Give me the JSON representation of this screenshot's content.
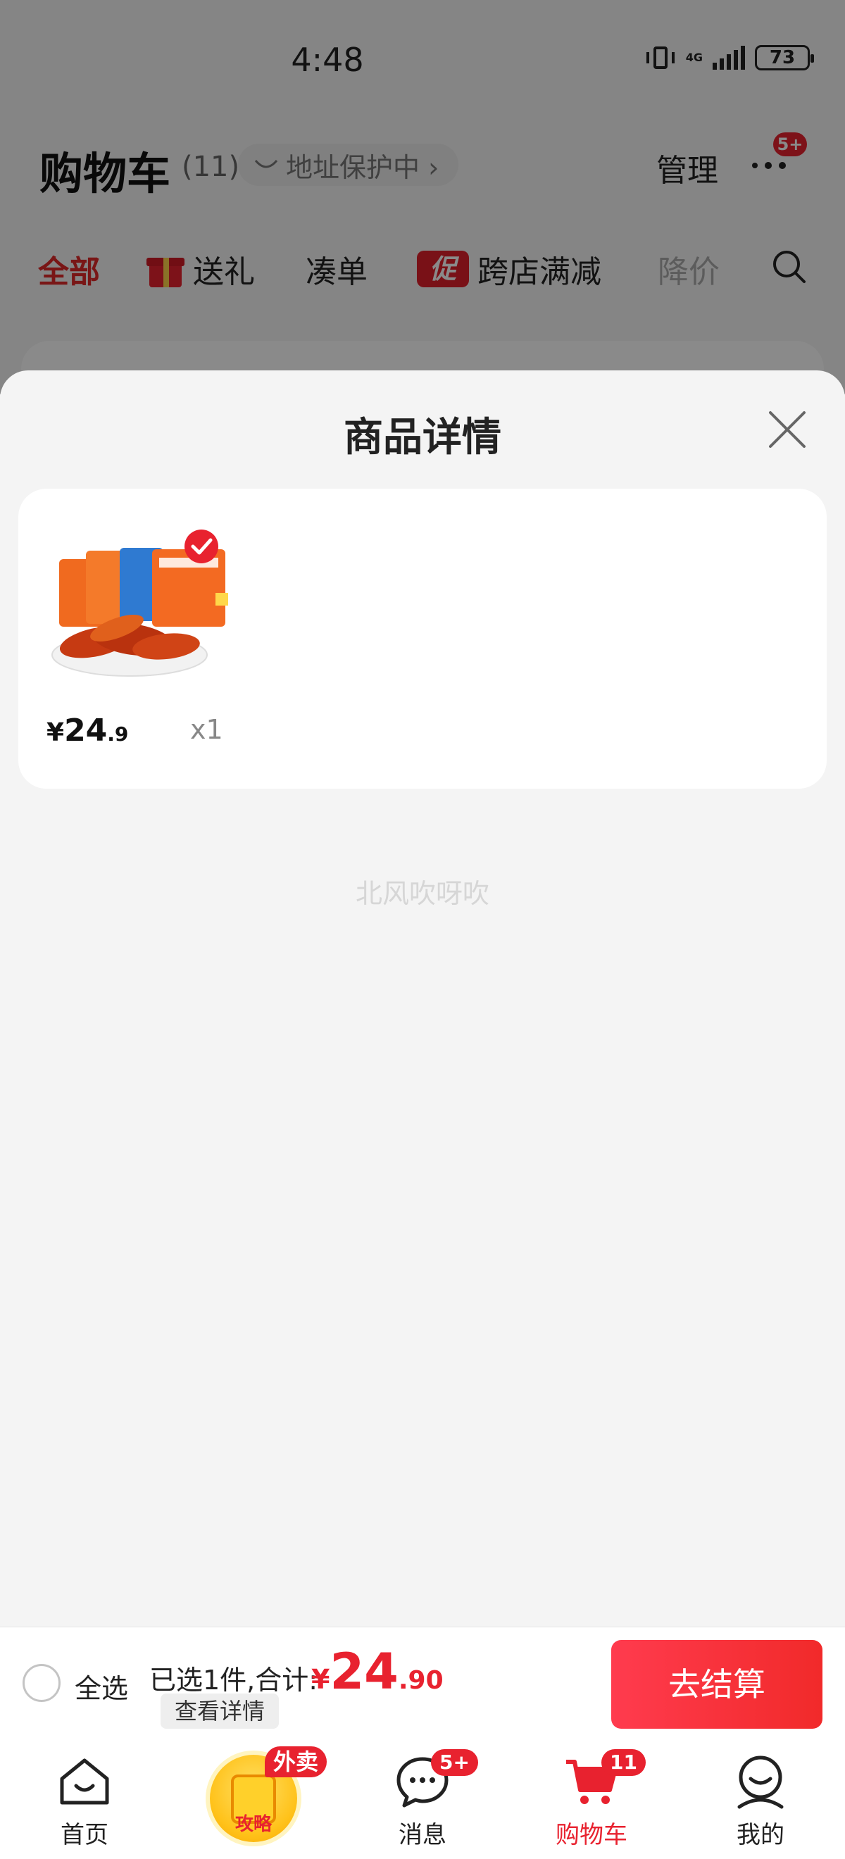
{
  "status_bar": {
    "time": "4:48",
    "network": "4G",
    "battery": "73"
  },
  "header": {
    "title": "购物车",
    "count": "(11)",
    "address_protection": "地址保护中 ›",
    "manage": "管理",
    "more_badge": "5+"
  },
  "filter_tabs": [
    {
      "label": "全部"
    },
    {
      "label": "送礼"
    },
    {
      "label": "凑单"
    },
    {
      "label": "跨店满减",
      "icon_text": "促"
    },
    {
      "label": "降价"
    }
  ],
  "sheet": {
    "title": "商品详情",
    "item": {
      "price_symbol": "¥",
      "price_integer": "24",
      "price_decimal": ".9",
      "quantity": "x1",
      "selected": true
    },
    "watermark": "北风吹呀吹"
  },
  "checkout": {
    "select_all": "全选",
    "selected_summary": "已选1件,合计:",
    "total_symbol": "¥",
    "total_integer": "24",
    "total_decimal": ".90",
    "view_details": "查看详情",
    "checkout_button": "去结算"
  },
  "tab_bar": [
    {
      "label": "首页",
      "icon": "home-icon"
    },
    {
      "label": "攻略",
      "icon": "guide-bag-icon",
      "badge": "外卖"
    },
    {
      "label": "消息",
      "icon": "message-icon",
      "badge": "5+"
    },
    {
      "label": "购物车",
      "icon": "cart-icon",
      "badge": "11",
      "active": true
    },
    {
      "label": "我的",
      "icon": "profile-icon"
    }
  ],
  "colors": {
    "accent": "#e8222f",
    "checkout_button": "#f12a2a",
    "sheet_background": "#f4f4f4"
  }
}
